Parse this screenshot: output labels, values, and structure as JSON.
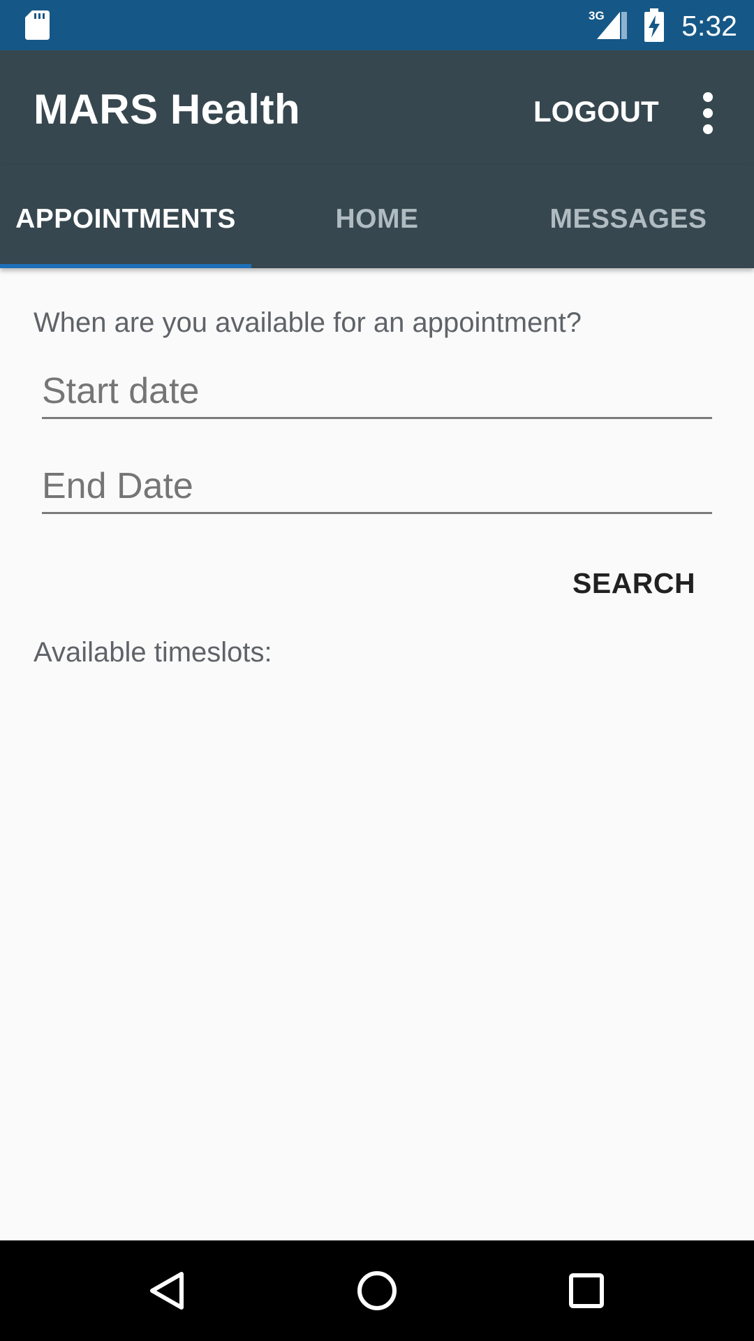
{
  "status_bar": {
    "time": "5:32",
    "network_label": "3G",
    "icons": [
      "sd-card-icon",
      "signal-3g-icon",
      "battery-charging-icon"
    ],
    "background_color": "#155887"
  },
  "toolbar": {
    "title": "MARS Health",
    "logout_label": "LOGOUT",
    "overflow_icon": "more-vertical-icon",
    "background_color": "#37474f"
  },
  "tabs": {
    "items": [
      {
        "label": "APPOINTMENTS",
        "active": true
      },
      {
        "label": "HOME",
        "active": false
      },
      {
        "label": "MESSAGES",
        "active": false
      }
    ],
    "indicator_color": "#1e6fb8"
  },
  "appointments": {
    "question": "When are you available for an appointment?",
    "start_date_placeholder": "Start date",
    "end_date_placeholder": "End Date",
    "search_label": "SEARCH",
    "timeslots_label": "Available timeslots:"
  },
  "nav_bar": {
    "icons": [
      "back-icon",
      "home-icon",
      "recent-apps-icon"
    ]
  }
}
